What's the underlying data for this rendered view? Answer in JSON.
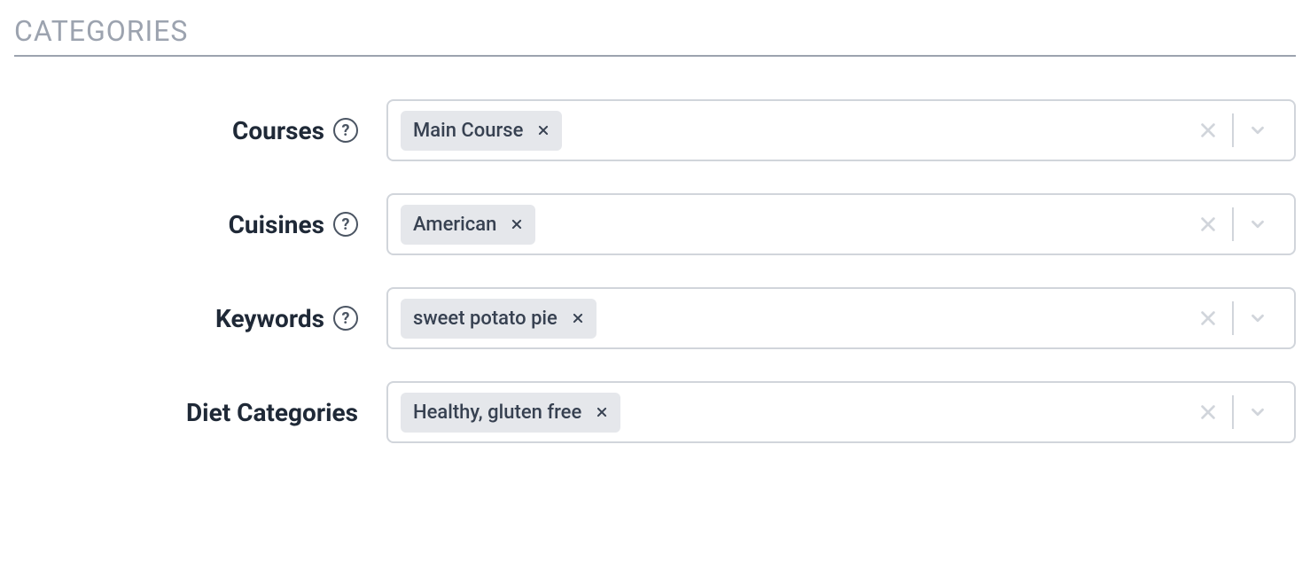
{
  "section": {
    "title": "CATEGORIES"
  },
  "fields": [
    {
      "label": "Courses",
      "hasHelp": true,
      "tags": [
        "Main Course"
      ]
    },
    {
      "label": "Cuisines",
      "hasHelp": true,
      "tags": [
        "American"
      ]
    },
    {
      "label": "Keywords",
      "hasHelp": true,
      "tags": [
        "sweet potato pie"
      ]
    },
    {
      "label": "Diet Categories",
      "hasHelp": false,
      "tags": [
        "Healthy, gluten free"
      ]
    }
  ]
}
